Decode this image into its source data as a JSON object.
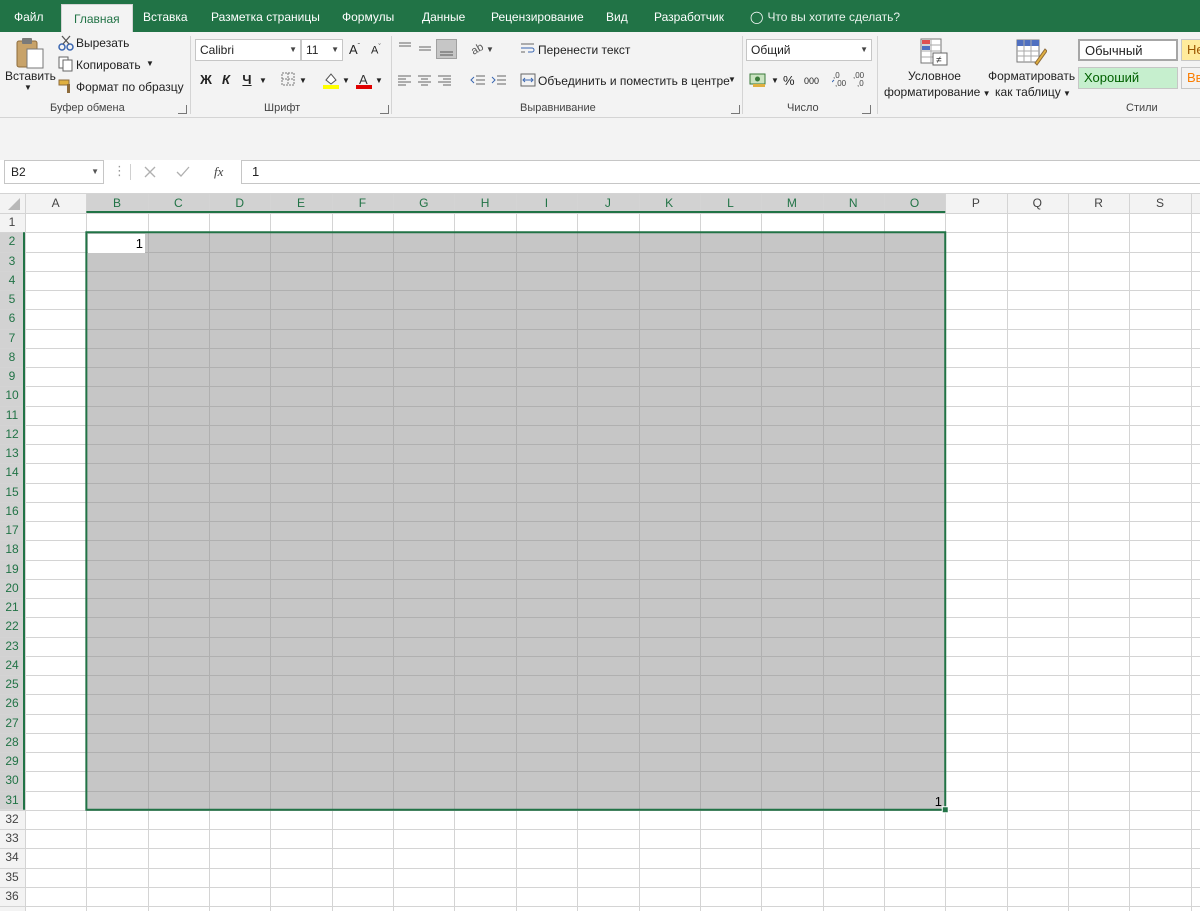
{
  "menu": {
    "items": [
      "Файл",
      "Главная",
      "Вставка",
      "Разметка страницы",
      "Формулы",
      "Данные",
      "Рецензирование",
      "Вид",
      "Разработчик"
    ],
    "tell_me": "Что вы хотите сделать?"
  },
  "clipboard": {
    "paste": "Вставить",
    "cut": "Вырезать",
    "copy": "Копировать",
    "format_painter": "Формат по образцу",
    "label": "Буфер обмена"
  },
  "font": {
    "name": "Calibri",
    "size": "11",
    "bold": "Ж",
    "italic": "К",
    "underline": "Ч",
    "label": "Шрифт"
  },
  "alignment": {
    "wrap": "Перенести текст",
    "merge": "Объединить и поместить в центре",
    "label": "Выравнивание"
  },
  "number": {
    "format": "Общий",
    "percent": "%",
    "thousands": "000",
    "label": "Число"
  },
  "styles": {
    "conditional": "Условное форматирование",
    "conditional_l1": "Условное",
    "conditional_l2": "форматирование",
    "as_table_l1": "Форматировать",
    "as_table_l2": "как таблицу",
    "normal": "Обычный",
    "good": "Хороший",
    "neutral": "Не",
    "check": "Вв",
    "label": "Стили"
  },
  "formula_bar": {
    "name_box": "B2",
    "fx": "fx",
    "value": "1"
  },
  "sheet": {
    "columns": [
      "A",
      "B",
      "C",
      "D",
      "E",
      "F",
      "G",
      "H",
      "I",
      "J",
      "K",
      "L",
      "M",
      "N",
      "O",
      "P",
      "Q",
      "R",
      "S"
    ],
    "rows": [
      "1",
      "2",
      "3",
      "4",
      "5",
      "6",
      "7",
      "8",
      "9",
      "10",
      "11",
      "12",
      "13",
      "14",
      "15",
      "16",
      "17",
      "18",
      "19",
      "20",
      "21",
      "22",
      "23",
      "24",
      "25",
      "26",
      "27",
      "28",
      "29",
      "30",
      "31",
      "32",
      "33",
      "34",
      "35",
      "36"
    ],
    "selection": "B2:O31",
    "cell_B2": "1",
    "cell_O31": "1"
  },
  "colors": {
    "accent": "#217346",
    "selection_fill": "#c6c6c6",
    "good_fill": "#c6efce",
    "good_text": "#006100",
    "neutral_fill": "#ffeb9c",
    "neutral_text": "#9c5700"
  }
}
